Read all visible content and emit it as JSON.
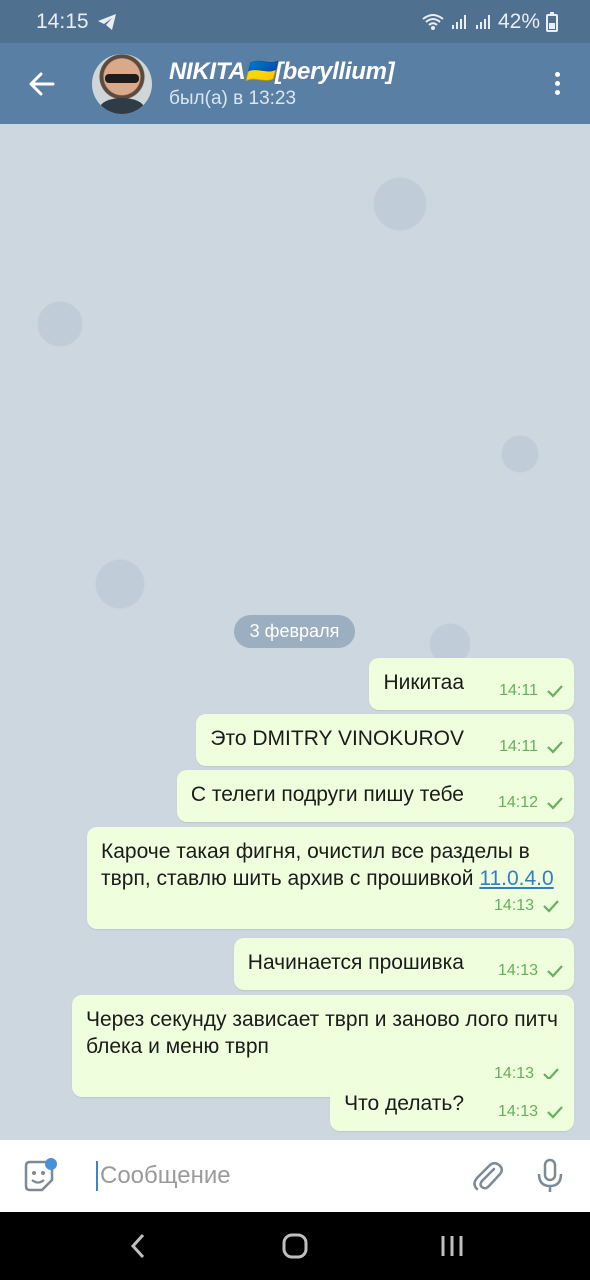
{
  "status": {
    "time": "14:15",
    "battery": "42%"
  },
  "header": {
    "name": "NIKITA🇺🇦[beryllium]",
    "last_seen": "был(а) в 13:23"
  },
  "chat": {
    "date": "3 февраля",
    "messages": [
      {
        "text": "Никитаа",
        "time": "14:11"
      },
      {
        "text": "Это DMITRY VINOKUROV",
        "time": "14:11"
      },
      {
        "text": "С телеги подруги пишу тебе",
        "time": "14:12"
      },
      {
        "text": "Кароче такая фигня, очистил все разделы в тврп, ставлю шить архив с прошивкой",
        "link": "11.0.4.0",
        "time": "14:13"
      },
      {
        "text": "Начинается прошивка",
        "time": "14:13"
      },
      {
        "text": "Через секунду зависает тврп и заново лого питч блека и меню тврп",
        "time": "14:13"
      },
      {
        "text": "Что делать?",
        "time": "14:13"
      }
    ]
  },
  "input": {
    "placeholder": "Сообщение"
  },
  "icons": {
    "back": "arrow-left-icon",
    "menu": "more-vert-icon",
    "emoji": "sticker-emoji-icon",
    "attach": "paperclip-icon",
    "mic": "microphone-icon"
  },
  "colors": {
    "header": "#5a7fa4",
    "outgoing_bubble": "#effedd",
    "check": "#64b05a"
  }
}
